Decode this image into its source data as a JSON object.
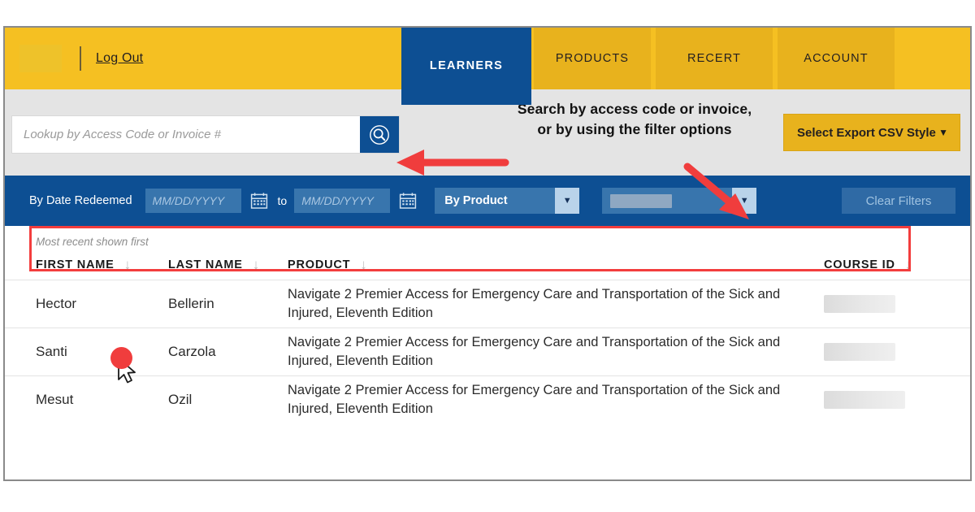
{
  "header": {
    "logo_redacted": true,
    "logout_label": "Log Out",
    "tabs": [
      {
        "label": "LEARNERS",
        "active": true
      },
      {
        "label": "PRODUCTS",
        "active": false
      },
      {
        "label": "RECERT",
        "active": false
      },
      {
        "label": "ACCOUNT",
        "active": false
      }
    ]
  },
  "search": {
    "placeholder": "Lookup by Access Code or Invoice #",
    "value": "",
    "button_icon": "search-icon"
  },
  "export": {
    "label": "Select Export CSV Style",
    "caret": "▼"
  },
  "annotation": {
    "text": "Search by access code or invoice, or by using the filter options",
    "arrow_color": "#f03d3d"
  },
  "filters": {
    "date_label": "By Date Redeemed",
    "date_from_placeholder": "MM/DD/YYYY",
    "date_from_value": "",
    "date_to_placeholder": "MM/DD/YYYY",
    "date_to_value": "",
    "to_word": "to",
    "product_select_label": "By Product",
    "secondary_select_value": "",
    "secondary_select_redacted": true,
    "caret": "▼",
    "clear_label": "Clear Filters",
    "calendar_icon": "calendar-icon"
  },
  "table": {
    "sort_note": "Most recent shown first",
    "sort_icon": "↓",
    "columns": [
      {
        "label": "FIRST NAME"
      },
      {
        "label": "LAST NAME"
      },
      {
        "label": "PRODUCT"
      },
      {
        "label": "COURSE ID"
      }
    ],
    "rows": [
      {
        "first_name": "Hector",
        "last_name": "Bellerin",
        "product": "Navigate 2 Premier Access for Emergency Care and Transportation of the Sick and Injured, Eleventh Edition",
        "course_id": "",
        "course_id_redacted": true,
        "highlighted": true
      },
      {
        "first_name": "Santi",
        "last_name": "Carzola",
        "product": "Navigate 2 Premier Access for Emergency Care and Transportation of the Sick and Injured, Eleventh Edition",
        "course_id": "",
        "course_id_redacted": true,
        "highlighted": false
      },
      {
        "first_name": "Mesut",
        "last_name": "Ozil",
        "product": "Navigate 2 Premier Access for Emergency Care and Transportation of the Sick and Injured, Eleventh Edition",
        "course_id": "",
        "course_id_redacted": true,
        "highlighted": false
      }
    ]
  },
  "colors": {
    "brand_yellow": "#f5c022",
    "tab_yellow": "#e8b21d",
    "brand_blue": "#0d4f93",
    "filter_input_blue": "#3875ad",
    "annotation_red": "#f03d3d",
    "gray_band": "#e4e4e4"
  }
}
